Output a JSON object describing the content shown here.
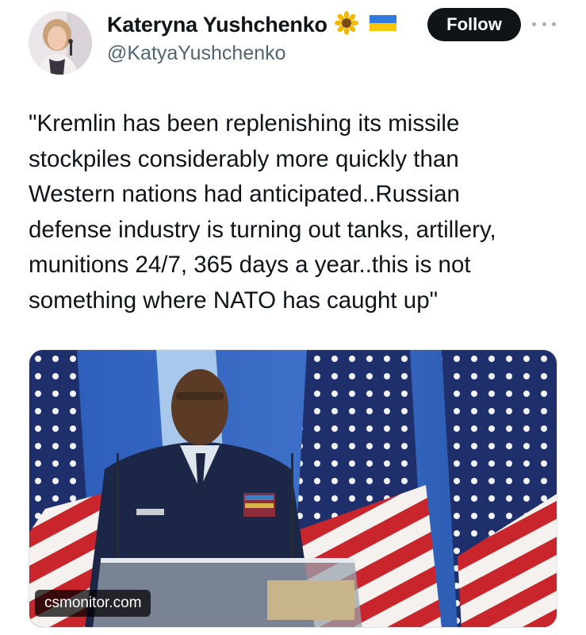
{
  "author": {
    "display_name": "Kateryna Yushchenko",
    "handle": "@KatyaYushchenko",
    "name_badges": [
      "sunflower-emoji",
      "ukraine-flag-emoji"
    ]
  },
  "actions": {
    "follow_label": "Follow"
  },
  "tweet": {
    "text": "\"Kremlin has been replenishing its missile\nstockpiles considerably more quickly than\nWestern nations had anticipated..Russian\ndefense industry is turning out tanks, artillery,\nmunitions 24/7, 365 days a year..this is not\nsomething where NATO has caught up\""
  },
  "media": {
    "source_domain": "csmonitor.com"
  },
  "colors": {
    "text": "#0f1419",
    "secondary_text": "#536471",
    "follow_bg": "#0f1419",
    "backdrop_blue": "#2a5bb8",
    "flag_red": "#c8262c",
    "flag_navy": "#1e2f6b",
    "uniform_navy": "#1c2747"
  }
}
